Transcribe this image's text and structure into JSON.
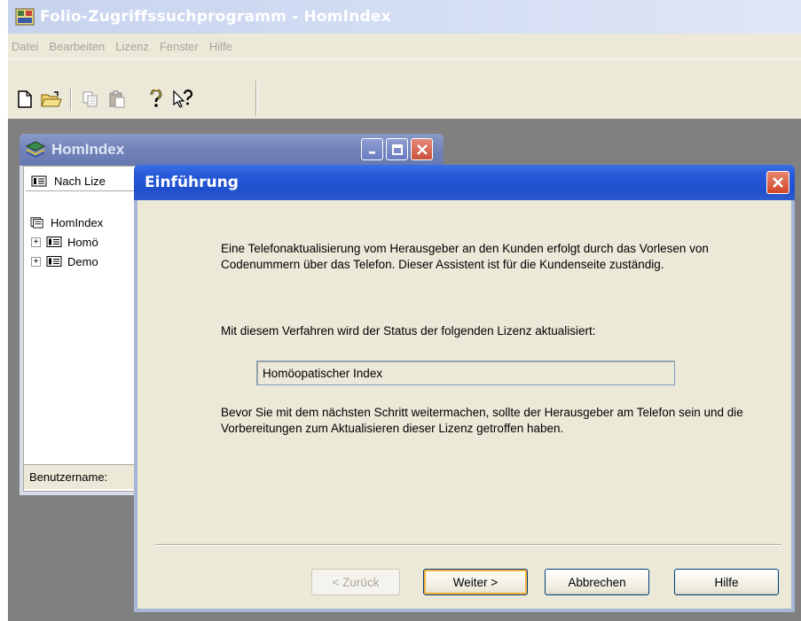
{
  "app": {
    "title": "Folio-Zugriffssuchprogramm - HomIndex",
    "menu": [
      "Datei",
      "Bearbeiten",
      "Lizenz",
      "Fenster",
      "Hilfe"
    ],
    "toolbar_icons": [
      "new-document-icon",
      "open-folder-icon",
      "copy-icon",
      "paste-icon",
      "help-icon",
      "context-help-icon"
    ]
  },
  "child_window": {
    "title": "HomIndex",
    "tab_label": "Nach Lize",
    "tree": {
      "root": "HomIndex",
      "items": [
        "Homö",
        "Demo"
      ]
    },
    "status_label": "Benutzername:"
  },
  "dialog": {
    "title": "Einführung",
    "paragraph1": "Eine Telefonaktualisierung vom Herausgeber an den Kunden erfolgt durch das Vorlesen von Codenummern über das Telefon. Dieser Assistent ist für die Kundenseite zuständig.",
    "paragraph2": "Mit diesem Verfahren wird der Status der folgenden Lizenz aktualisiert:",
    "license_name": "Homöopatischer Index",
    "paragraph3": "Bevor Sie mit dem nächsten Schritt weitermachen, sollte der Herausgeber am Telefon sein und die Vorbereitungen zum Aktualisieren dieser Lizenz getroffen haben.",
    "buttons": {
      "back": "< Zurück",
      "next": "Weiter >",
      "cancel": "Abbrechen",
      "help": "Hilfe"
    }
  }
}
